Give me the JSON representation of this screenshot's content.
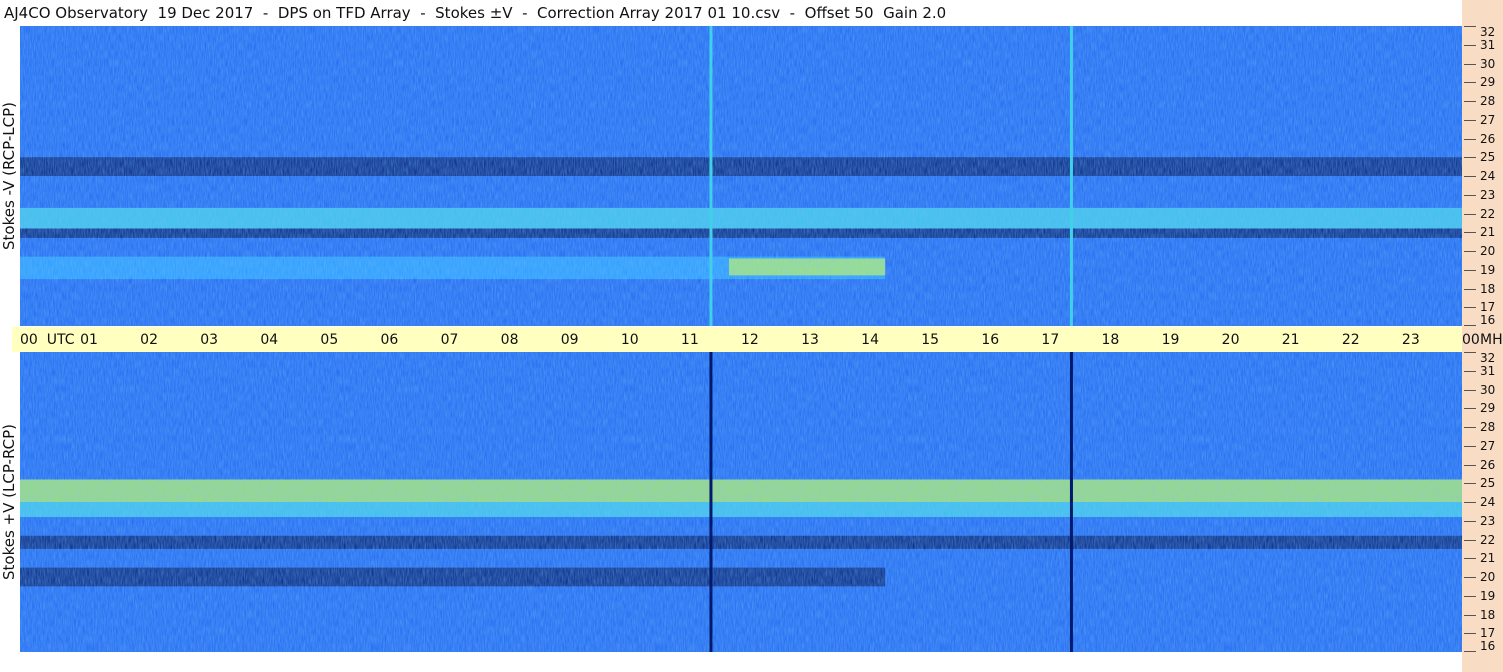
{
  "title": "AJ4CO Observatory  19 Dec 2017  -  DPS on TFD Array  -  Stokes ±V  -  Correction Array 2017 01 10.csv  -  Offset 50  Gain 2.0",
  "panels": [
    {
      "id": "top",
      "label": "Stokes -V (RCP-LCP)"
    },
    {
      "id": "bottom",
      "label": "Stokes +V (LCP-RCP)"
    }
  ],
  "time_axis": {
    "labels": [
      "00  UTC",
      "01",
      "02",
      "03",
      "04",
      "05",
      "06",
      "07",
      "08",
      "09",
      "10",
      "11",
      "12",
      "13",
      "14",
      "15",
      "16",
      "17",
      "18",
      "19",
      "20",
      "21",
      "22",
      "23",
      "00"
    ],
    "unit": "MHz"
  },
  "freq_axis_labels": [
    "32",
    "31",
    "30",
    "29",
    "28",
    "27",
    "26",
    "25",
    "24",
    "23",
    "22",
    "21",
    "20",
    "19",
    "18",
    "17",
    "16"
  ],
  "colors": {
    "deep": "#001a6e",
    "background": "#1e66f0",
    "bright": "#2aa4ff",
    "cyan": "#40d0e8",
    "green": "#b4f060",
    "axis_band": "#ffffc0",
    "side_strip": "#f9dcc4"
  },
  "chart_data": {
    "type": "heatmap",
    "x_unit": "UTC hour",
    "y_unit": "MHz",
    "xlim": [
      0,
      24
    ],
    "ylim": [
      16,
      32
    ],
    "panels": [
      {
        "label": "Stokes -V (RCP-LCP)",
        "bands": [
          {
            "from": 24.0,
            "to": 25.0,
            "level": "deep"
          },
          {
            "from": 21.2,
            "to": 22.3,
            "level": "cyan"
          },
          {
            "from": 20.7,
            "to": 21.2,
            "level": "deep"
          },
          {
            "from": 18.5,
            "to": 19.7,
            "level": "bright",
            "until_hour": 14.4
          },
          {
            "from": 18.7,
            "to": 19.6,
            "level": "green",
            "from_hour": 11.8,
            "until_hour": 14.4
          }
        ],
        "vertical_lines": [
          {
            "hour": 11.5,
            "level": "cyan"
          },
          {
            "hour": 17.5,
            "level": "cyan"
          }
        ]
      },
      {
        "label": "Stokes +V (LCP-RCP)",
        "bands": [
          {
            "from": 24.0,
            "to": 25.2,
            "level": "green"
          },
          {
            "from": 23.2,
            "to": 24.0,
            "level": "cyan"
          },
          {
            "from": 21.5,
            "to": 22.2,
            "level": "deep"
          },
          {
            "from": 19.5,
            "to": 20.5,
            "level": "deep",
            "until_hour": 14.4
          }
        ],
        "vertical_lines": [
          {
            "hour": 11.5,
            "level": "deep"
          },
          {
            "hour": 17.5,
            "level": "deep"
          }
        ]
      }
    ]
  }
}
